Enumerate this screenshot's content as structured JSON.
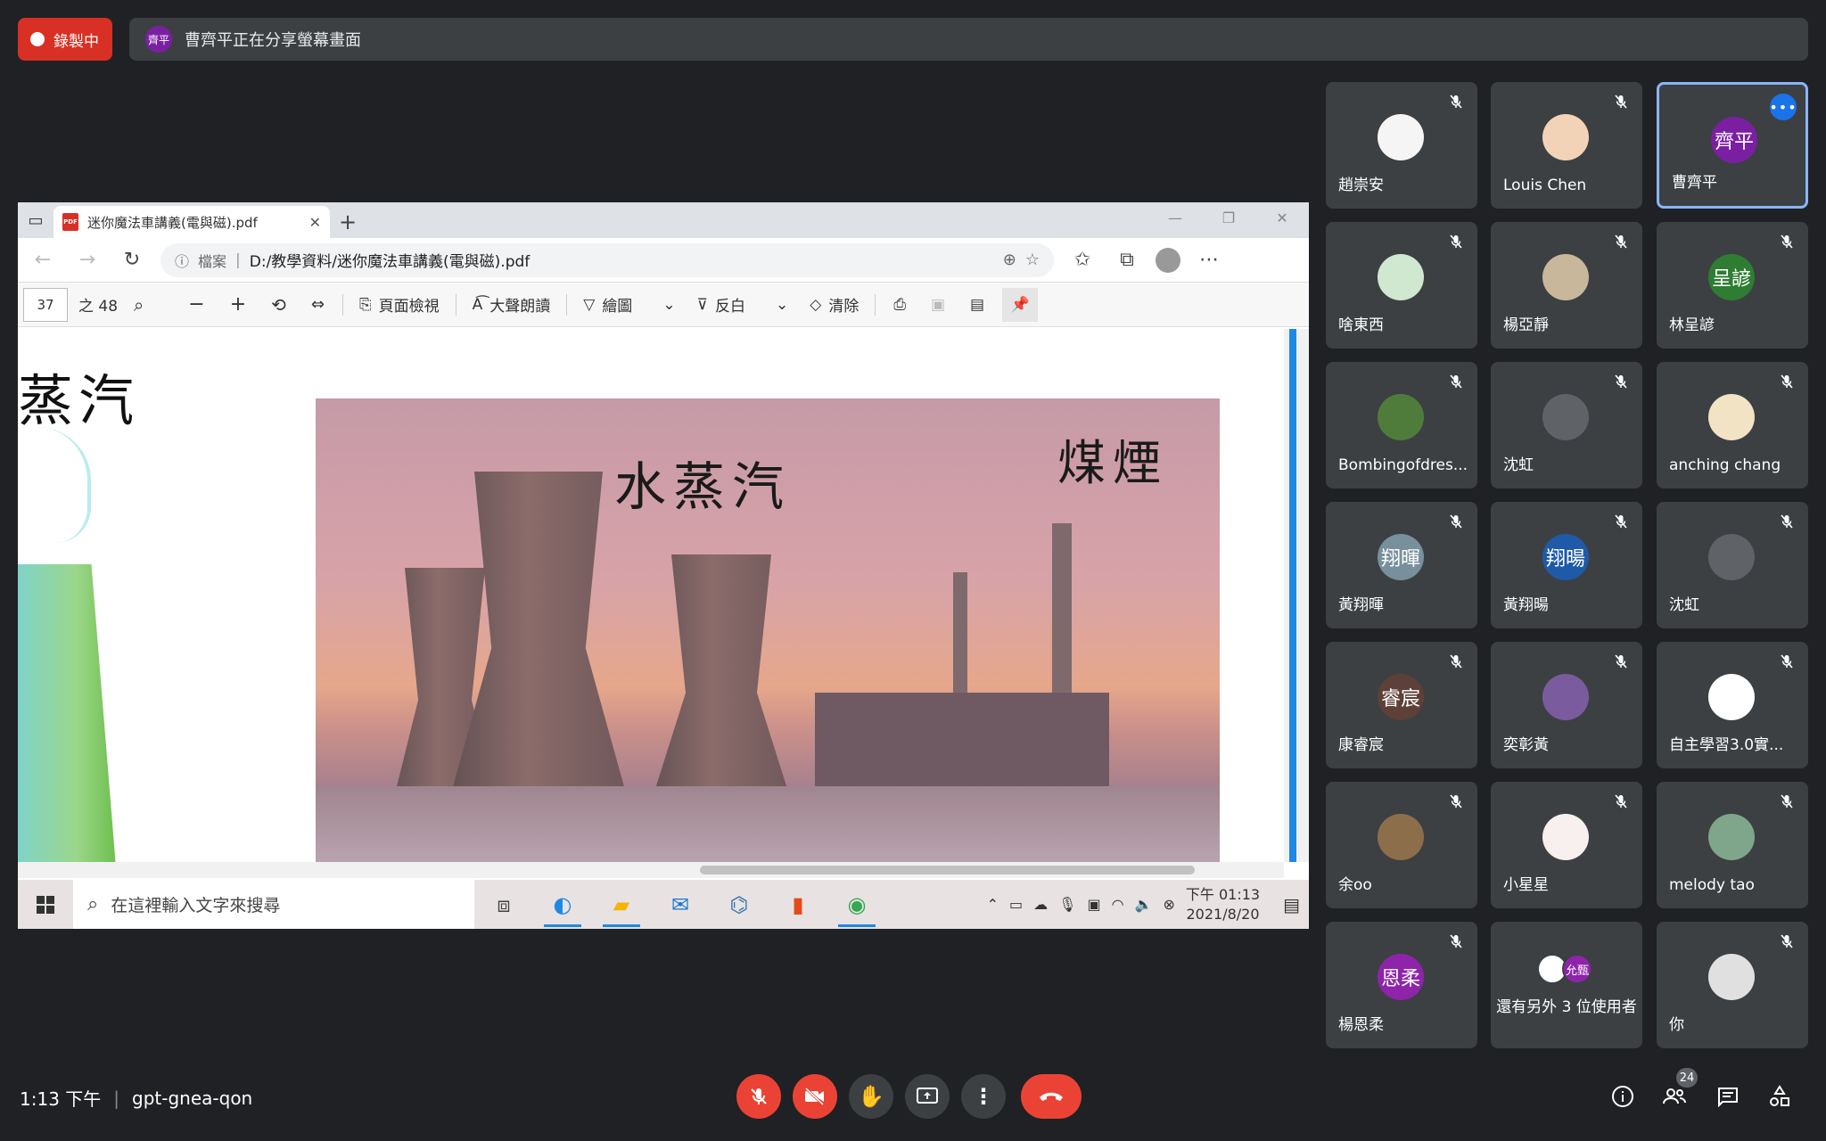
{
  "recording": {
    "label": "錄製中"
  },
  "share_banner": {
    "avatar_text": "齊平",
    "text": "曹齊平正在分享螢幕畫面"
  },
  "browser": {
    "tab_title": "迷你魔法車講義(電與磁).pdf",
    "url_prefix": "檔案",
    "url": "D:/教學資料/迷你魔法車講義(電與磁).pdf",
    "pdf_toolbar": {
      "page_current": "37",
      "page_total": "之 48",
      "page_view": "頁面檢視",
      "read_aloud": "大聲朗讀",
      "draw": "繪圖",
      "highlight": "反白",
      "erase": "清除"
    },
    "pdf_content": {
      "left_heading": "蒸汽",
      "label_steam": "水蒸汽",
      "label_smoke": "煤煙"
    },
    "taskbar": {
      "search_placeholder": "在這裡輸入文字來搜尋",
      "time": "下午 01:13",
      "date": "2021/8/20"
    }
  },
  "participants": [
    {
      "name": "趙崇安",
      "avatar": "",
      "color": "#f5f5f5"
    },
    {
      "name": "Louis Chen",
      "avatar": "",
      "color": "#f3d3b8"
    },
    {
      "name": "曹齊平",
      "avatar": "齊平",
      "color": "#7b1fa2",
      "active": true
    },
    {
      "name": "啥東西",
      "avatar": "",
      "color": "#cfe8cf"
    },
    {
      "name": "楊亞靜",
      "avatar": "",
      "color": "#c9b79c"
    },
    {
      "name": "林呈諺",
      "avatar": "呈諺",
      "color": "#2e7d32"
    },
    {
      "name": "Bombingofdres...",
      "avatar": "",
      "color": "#4f7c3a"
    },
    {
      "name": "沈虹",
      "avatar": "",
      "color": "#5f6368"
    },
    {
      "name": "anching chang",
      "avatar": "",
      "color": "#f2e3c4"
    },
    {
      "name": "黃翔暉",
      "avatar": "翔暉",
      "color": "#78909c"
    },
    {
      "name": "黃翔暘",
      "avatar": "翔暘",
      "color": "#1e5aa8"
    },
    {
      "name": "沈虹",
      "avatar": "",
      "color": "#5f6368"
    },
    {
      "name": "康睿宸",
      "avatar": "睿宸",
      "color": "#5d4037"
    },
    {
      "name": "奕彰黃",
      "avatar": "",
      "color": "#7a5c9e"
    },
    {
      "name": "自主學習3.0實...",
      "avatar": "",
      "color": "#ffffff"
    },
    {
      "name": "余oo",
      "avatar": "",
      "color": "#8d6e4a"
    },
    {
      "name": "小星星",
      "avatar": "",
      "color": "#f8f0ee"
    },
    {
      "name": "melody tao",
      "avatar": "",
      "color": "#7fa58a"
    },
    {
      "name": "楊恩柔",
      "avatar": "恩柔",
      "color": "#8e24aa"
    },
    {
      "name": "還有另外 3 位使用者",
      "avatar": "允甄",
      "color": "#8e24aa",
      "others": true
    },
    {
      "name": "你",
      "avatar": "",
      "color": "#e0e0e0"
    }
  ],
  "meeting": {
    "time": "1:13 下午",
    "code": "gpt-gnea-qon",
    "participant_count": "24"
  }
}
